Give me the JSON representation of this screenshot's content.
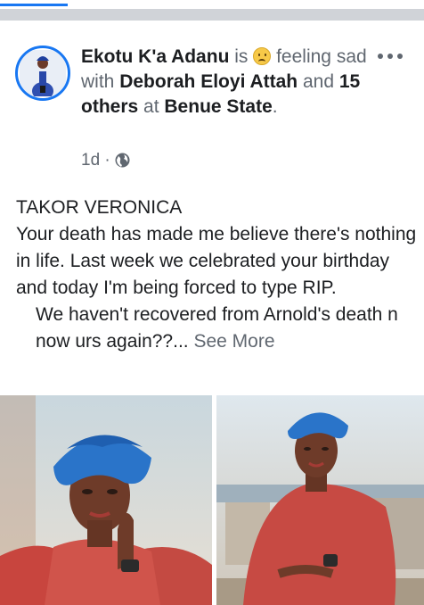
{
  "post": {
    "author": "Ekotu K'a Adanu",
    "is": "is",
    "feeling_label": "feeling",
    "feeling": "sad",
    "with_label": "with",
    "tagged_person": "Deborah Eloyi Attah",
    "and_label": "and",
    "others": "15 others",
    "at_label": "at",
    "location": "Benue State",
    "time": "1d",
    "separator": "·",
    "text_line1": "TAKOR VERONICA",
    "text_para1": "Your death has made me believe there's nothing in life. Last week we celebrated your birthday and today I'm being forced to type RIP.",
    "text_para2": "We haven't recovered from Arnold's death n now urs again??...",
    "see_more": "See More"
  },
  "icons": {
    "feeling": "sad-face-emoji-icon",
    "more": "more-horizontal-icon",
    "privacy": "globe-icon"
  },
  "colors": {
    "brand_blue": "#1877f2",
    "secondary_text": "#606770",
    "primary_text": "#1c1e21",
    "divider": "#d0d3d8"
  }
}
